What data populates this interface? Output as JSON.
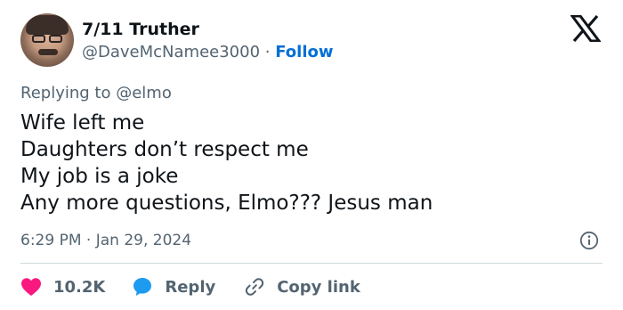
{
  "author": {
    "display_name": "7/11 Truther",
    "handle": "@DaveMcNamee3000",
    "separator": "·",
    "follow_label": "Follow"
  },
  "reply_context": {
    "prefix": "Replying to ",
    "mention": "@elmo"
  },
  "tweet": {
    "lines": [
      "Wife left me",
      "Daughters don’t respect me",
      "My job is a joke",
      "Any more questions, Elmo??? Jesus man"
    ],
    "timestamp": "6:29 PM · Jan 29, 2024"
  },
  "actions": {
    "like_count": "10.2K",
    "reply_label": "Reply",
    "copy_link_label": "Copy link"
  },
  "colors": {
    "text": "#0f1419",
    "secondary": "#536471",
    "follow": "#006fd6",
    "like": "#f91880",
    "reply": "#1d9bf0",
    "divider": "#cfd9de"
  },
  "icons": {
    "brand": "x-logo-icon",
    "info": "info-icon",
    "like": "heart-icon",
    "reply": "speech-bubble-icon",
    "copy_link": "link-icon"
  }
}
